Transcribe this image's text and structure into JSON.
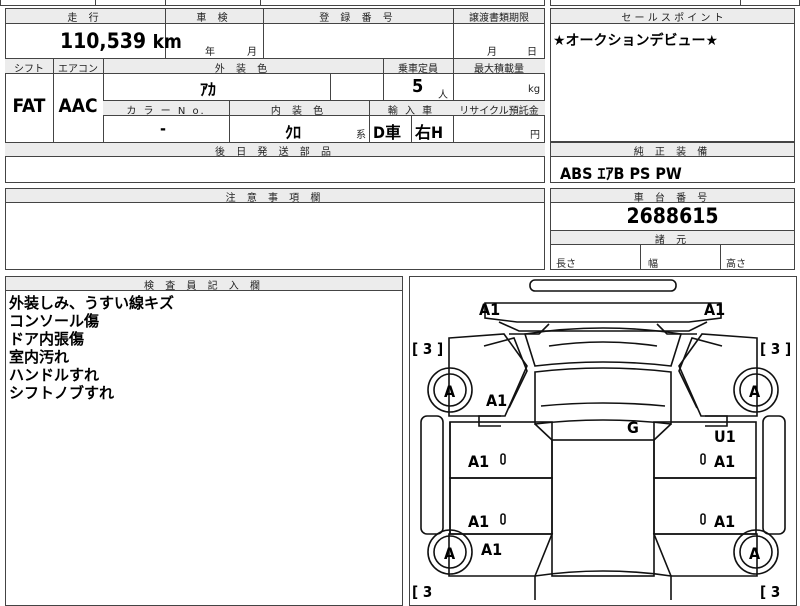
{
  "header": {
    "mileage_label": "走 行",
    "inspection_label": "車 検",
    "registration_label": "登 録 番 号",
    "transfer_label": "譲渡書類期限",
    "sales_point_label": "セ ー ル ス ポ イ ン ト",
    "mileage_value": "110,539",
    "mileage_unit": "km",
    "insp_year_unit": "年",
    "insp_month_unit": "月",
    "transfer_month_unit": "月",
    "transfer_day_unit": "日",
    "sales_point_text": "★オークションデビュー★"
  },
  "spec": {
    "shift_label": "シフト",
    "ac_label": "エアコン",
    "ext_color_label": "外 装 色",
    "capacity_label": "乗車定員",
    "max_load_label": "最大積載量",
    "shift_value": "FAT",
    "ac_value": "AAC",
    "ext_color_value": "ｱｶ",
    "capacity_value": "5",
    "capacity_unit": "人",
    "max_load_unit": "kg",
    "color_no_label": "カ ラ ー N o.",
    "int_color_label": "内 装 色",
    "import_label": "輸 入 車",
    "recycle_label": "リサイクル預託金",
    "color_no_value": "-",
    "int_color_value": "ｸﾛ",
    "int_color_suffix": "系",
    "import_value": "D車",
    "steering_value": "右H",
    "recycle_unit": "円",
    "later_parts_label": "後 日 発 送 部 品"
  },
  "equipment": {
    "label": "純 正 装 備",
    "value": "ABS ｴｱB PS PW"
  },
  "notes": {
    "label": "注 意 事 項 欄"
  },
  "chassis": {
    "label": "車 台 番 号",
    "value": "2688615",
    "dims_label": "諸 元",
    "length_label": "長さ",
    "width_label": "幅",
    "height_label": "高さ"
  },
  "inspector": {
    "label": "検 査 員 記 入 欄",
    "lines": [
      "外装しみ、うすい線キズ",
      "コンソール傷",
      "ドア内張傷",
      "室内汚れ",
      "ハンドルすれ",
      "シフトノブすれ"
    ]
  },
  "diagram": {
    "a1_front_left": "A1",
    "a1_front_right": "A1",
    "bracket_fl": "[ 3 ]",
    "bracket_fr": "[ 3 ]",
    "bracket_rl": "[ 3",
    "bracket_rr": "[ 3",
    "tire_fl": "A",
    "tire_fr": "A",
    "tire_rl": "A",
    "tire_rr": "A",
    "fender_fl": "A1",
    "glass": "G",
    "u1_right": "U1",
    "door_fl": "A1",
    "door_fr": "A1",
    "door_rl": "A1",
    "door_rr": "A1",
    "quarter_rl": "A1"
  }
}
